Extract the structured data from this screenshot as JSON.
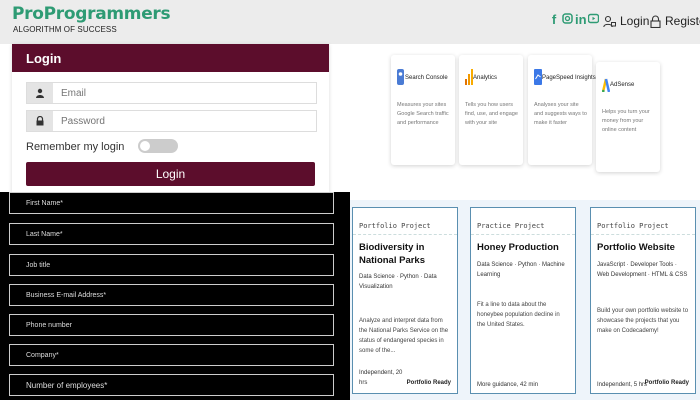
{
  "header": {
    "brand": "ProProgrammers",
    "tagline": "ALGORITHM OF SUCCESS",
    "social_icons": [
      "facebook-icon",
      "instagram-icon",
      "linkedin-icon",
      "youtube-icon"
    ],
    "login_label": "Login",
    "register_label": "Register"
  },
  "login": {
    "title": "Login",
    "email_placeholder": "Email",
    "password_placeholder": "Password",
    "remember_label": "Remember my login",
    "button_label": "Login"
  },
  "tools": [
    {
      "name": "Search Console",
      "desc": "Measures your sites Google Search traffic and performance",
      "color": "#4a7bd4"
    },
    {
      "name": "Analytics",
      "desc": "Tells you how users find, use, and engage with your site",
      "color": "#f29900"
    },
    {
      "name": "PageSpeed Insights",
      "desc": "Analyses your site and suggests ways to make it faster",
      "color": "#3b78e7"
    },
    {
      "name": "AdSense",
      "desc": "Helps you turn your money from your online content",
      "color": "#fbbc04"
    }
  ],
  "form_fields": [
    "First Name*",
    "Last Name*",
    "Job title",
    "Business E-mail Address*",
    "Phone number",
    "Company*",
    "Number of employees*"
  ],
  "courses": [
    {
      "type": "Portfolio Project",
      "title": "Biodiversity in National Parks",
      "subjects": "Data Science · Python · Data Visualization",
      "desc": "Analyze and interpret data from the National Parks Service on the status of endangered species in some of the...",
      "footer": "Independent, 20 hrs",
      "badge": "Portfolio Ready"
    },
    {
      "type": "Practice Project",
      "title": "Honey Production",
      "subjects": "Data Science · Python · Machine Learning",
      "desc": "Fit a line to data about the honeybee population decline in the United States.",
      "footer": "More guidance, 42 min",
      "badge": ""
    },
    {
      "type": "Portfolio Project",
      "title": "Portfolio Website",
      "subjects": "JavaScript · Developer Tools · Web Development · HTML & CSS",
      "desc": "Build your own portfolio website to showcase the projects that you make on Codecademy!",
      "footer": "Independent, 5 hrs",
      "badge": "Portfolio Ready"
    }
  ]
}
